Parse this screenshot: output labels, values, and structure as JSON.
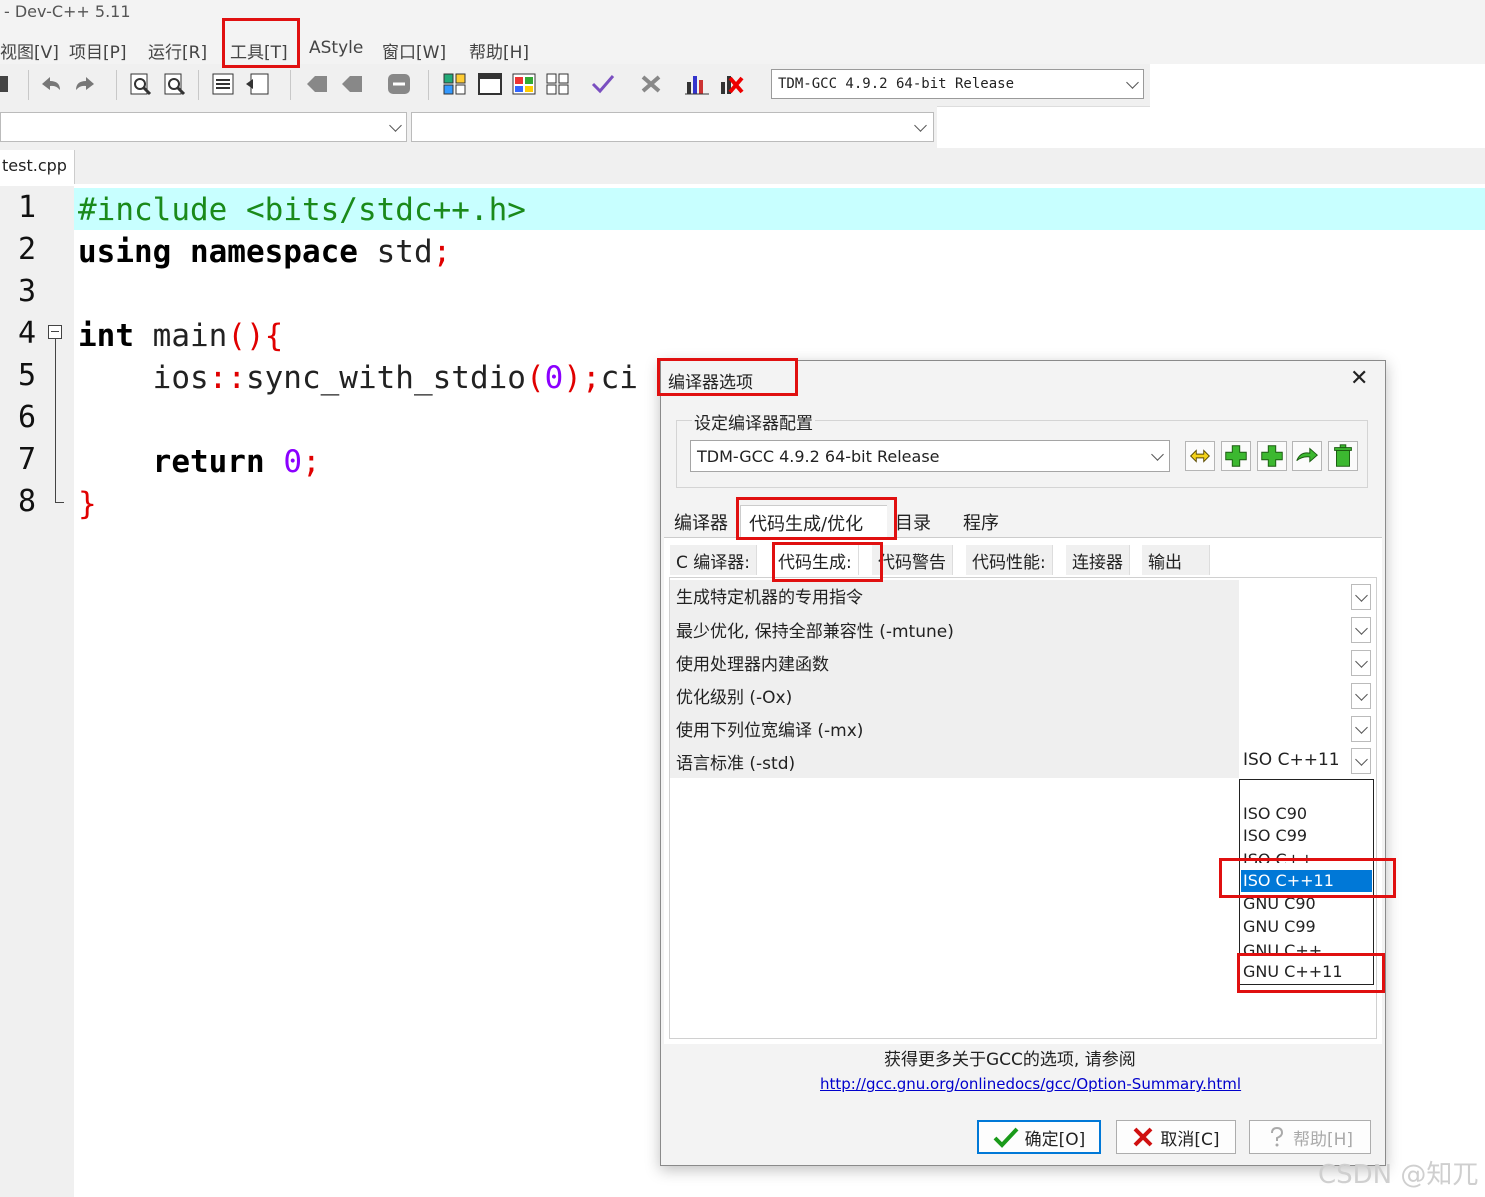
{
  "window": {
    "title": "- Dev-C++ 5.11"
  },
  "menu": {
    "items": [
      "视图[V]",
      "项目[P]",
      "运行[R]",
      "工具[T]",
      "AStyle",
      "窗口[W]",
      "帮助[H]"
    ]
  },
  "toolbar": {
    "compiler_select": "TDM-GCC 4.9.2 64-bit Release"
  },
  "file_tab": "test.cpp",
  "editor": {
    "line_numbers": [
      "1",
      "2",
      "3",
      "4",
      "5",
      "6",
      "7",
      "8"
    ],
    "lines": {
      "l1": "#include <bits/stdc++.h>",
      "l2a": "using namespace",
      "l2b": " std",
      "l2c": ";",
      "l4a": "int",
      "l4b": " main",
      "l4c": "(){",
      "l5a": "    ios",
      "l5b": "::",
      "l5c": "sync_with_stdio",
      "l5d": "(",
      "l5e": "0",
      "l5f": ");",
      "l5g": "ci",
      "l7a": "    return",
      "l7b": " ",
      "l7c": "0",
      "l7d": ";",
      "l8": "}"
    }
  },
  "dialog": {
    "title": "编译器选项",
    "close": "✕",
    "group_label": "设定编译器配置",
    "config_select": "TDM-GCC 4.9.2 64-bit Release",
    "main_tabs": [
      "编译器",
      "代码生成/优化",
      "目录",
      "程序"
    ],
    "sub_tabs": [
      "C 编译器:",
      "代码生成:",
      "代码警告",
      "代码性能:",
      "连接器",
      "输出"
    ],
    "options": [
      "生成特定机器的专用指令",
      "最少优化, 保持全部兼容性 (-mtune)",
      "使用处理器内建函数",
      "优化级别 (-Ox)",
      "使用下列位宽编译 (-mx)",
      "语言标准 (-std)"
    ],
    "language_std_value": "ISO C++11",
    "dropdown_options": [
      "",
      "ISO C90",
      "ISO C99",
      "ISO C++",
      "ISO C++11",
      "GNU C90",
      "GNU C99",
      "GNU C++",
      "GNU C++11"
    ],
    "selected_option": "ISO C++11",
    "info_text": "获得更多关于GCC的选项, 请参阅",
    "link": "http://gcc.gnu.org/onlinedocs/gcc/Option-Summary.html",
    "buttons": {
      "ok": "确定[O]",
      "cancel": "取消[C]",
      "help": "帮助[H]"
    }
  },
  "watermark": "CSDN @知兀",
  "colors": {
    "highlight_line": "#c8ffff",
    "selection": "#0078d7",
    "annotation": "#e01010"
  }
}
